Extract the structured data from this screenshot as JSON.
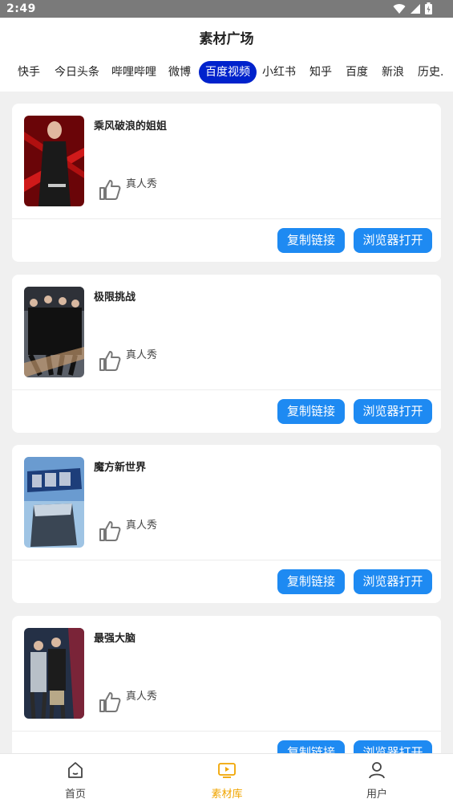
{
  "status_bar": {
    "time": "2:49"
  },
  "header": {
    "title": "素材广场"
  },
  "tabs": [
    {
      "label": "快手"
    },
    {
      "label": "今日头条"
    },
    {
      "label": "哔哩哔哩"
    },
    {
      "label": "微博"
    },
    {
      "label": "百度视频",
      "active": true
    },
    {
      "label": "小红书"
    },
    {
      "label": "知乎"
    },
    {
      "label": "百度"
    },
    {
      "label": "新浪"
    },
    {
      "label": "历史."
    }
  ],
  "cards": [
    {
      "title": "乘风破浪的姐姐",
      "tag": "真人秀",
      "copy_label": "复制链接",
      "open_label": "浏览器打开"
    },
    {
      "title": "极限挑战",
      "tag": "真人秀",
      "copy_label": "复制链接",
      "open_label": "浏览器打开"
    },
    {
      "title": "魔方新世界",
      "tag": "真人秀",
      "copy_label": "复制链接",
      "open_label": "浏览器打开"
    },
    {
      "title": "最强大脑",
      "tag": "真人秀",
      "copy_label": "复制链接",
      "open_label": "浏览器打开"
    }
  ],
  "bottom_nav": [
    {
      "label": "首页",
      "icon": "home-icon"
    },
    {
      "label": "素材库",
      "icon": "library-icon",
      "active": true
    },
    {
      "label": "用户",
      "icon": "user-icon"
    }
  ],
  "colors": {
    "accent": "#1e8af2",
    "active_tab": "#0022cc",
    "nav_active": "#f0a500"
  }
}
